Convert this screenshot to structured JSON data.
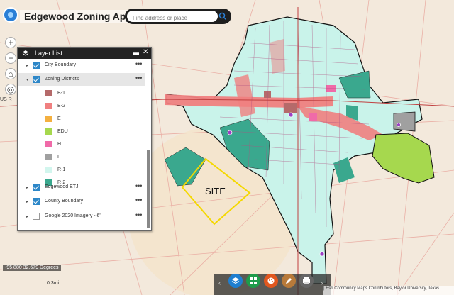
{
  "header": {
    "title": "Edgewood Zoning App Public",
    "search_placeholder": "Find address or place"
  },
  "left_tools": {
    "zoom_in": "+",
    "zoom_out": "−",
    "home": "⌂",
    "locate": "◎",
    "map_label": "US R"
  },
  "layer_list": {
    "title": "Layer List",
    "layers": [
      {
        "label": "City Boundary",
        "checked": true
      },
      {
        "label": "Zoning Districts",
        "checked": true
      },
      {
        "label": "Edgewood ETJ",
        "checked": true
      },
      {
        "label": "County Boundary",
        "checked": true
      },
      {
        "label": "Google 2020 Imagery - 6\"",
        "checked": false
      }
    ],
    "legend": [
      {
        "label": "B-1",
        "color": "#b56a6a"
      },
      {
        "label": "B-2",
        "color": "#f08080"
      },
      {
        "label": "E",
        "color": "#f4b040"
      },
      {
        "label": "EDU",
        "color": "#a6d84e"
      },
      {
        "label": "H",
        "color": "#f06aa8"
      },
      {
        "label": "I",
        "color": "#a0a0a0"
      },
      {
        "label": "R-1",
        "color": "#d2f6ee"
      },
      {
        "label": "R-2",
        "color": "#3aa88e"
      }
    ]
  },
  "map": {
    "coordinates": "-95.880 32.679 Degrees",
    "scale_label": "0.3mi",
    "site_label": "SITE",
    "attribution": "| Esri Community Maps Contributors, Baylor University, Texas"
  },
  "colors": {
    "r1": "#c9f3ea",
    "r2": "#3aa88e",
    "b2": "#f08080",
    "edu": "#a6d84e",
    "site": "#f4d800"
  }
}
